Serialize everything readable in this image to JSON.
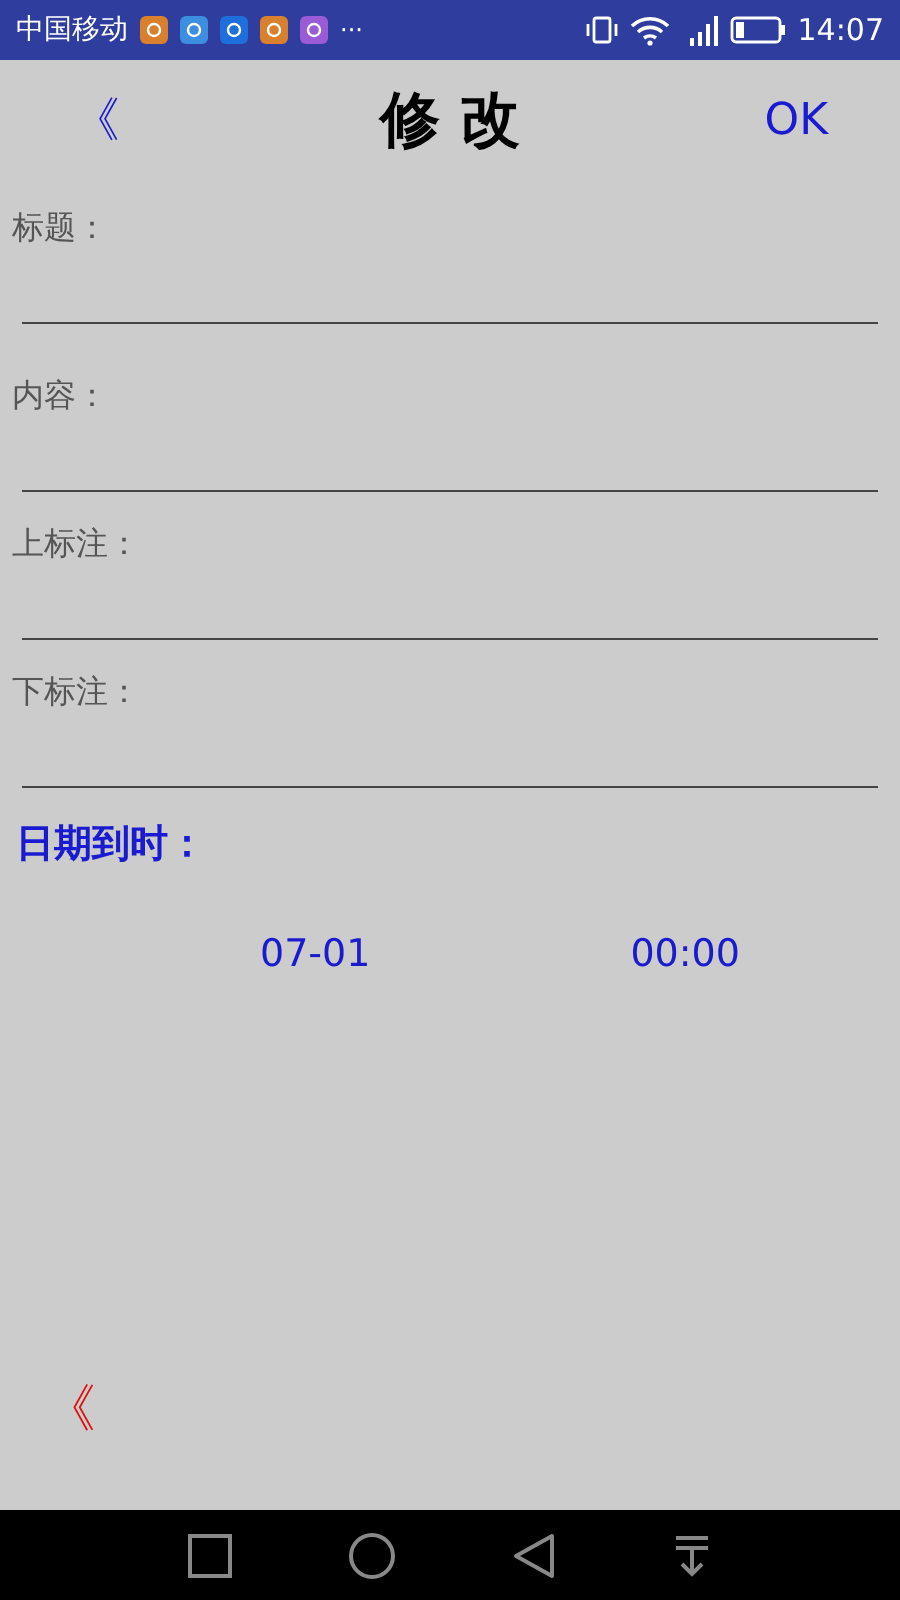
{
  "status_bar": {
    "carrier": "中国移动",
    "more": "···",
    "time": "14:07"
  },
  "header": {
    "back": "《",
    "title": "修 改",
    "confirm": "OK"
  },
  "fields": [
    {
      "label": "标题："
    },
    {
      "label": "内容："
    },
    {
      "label": "上标注："
    },
    {
      "label": "下标注："
    }
  ],
  "due": {
    "label": "日期到时：",
    "date": "07-01",
    "time": "00:00"
  },
  "footer": {
    "back": "《"
  }
}
